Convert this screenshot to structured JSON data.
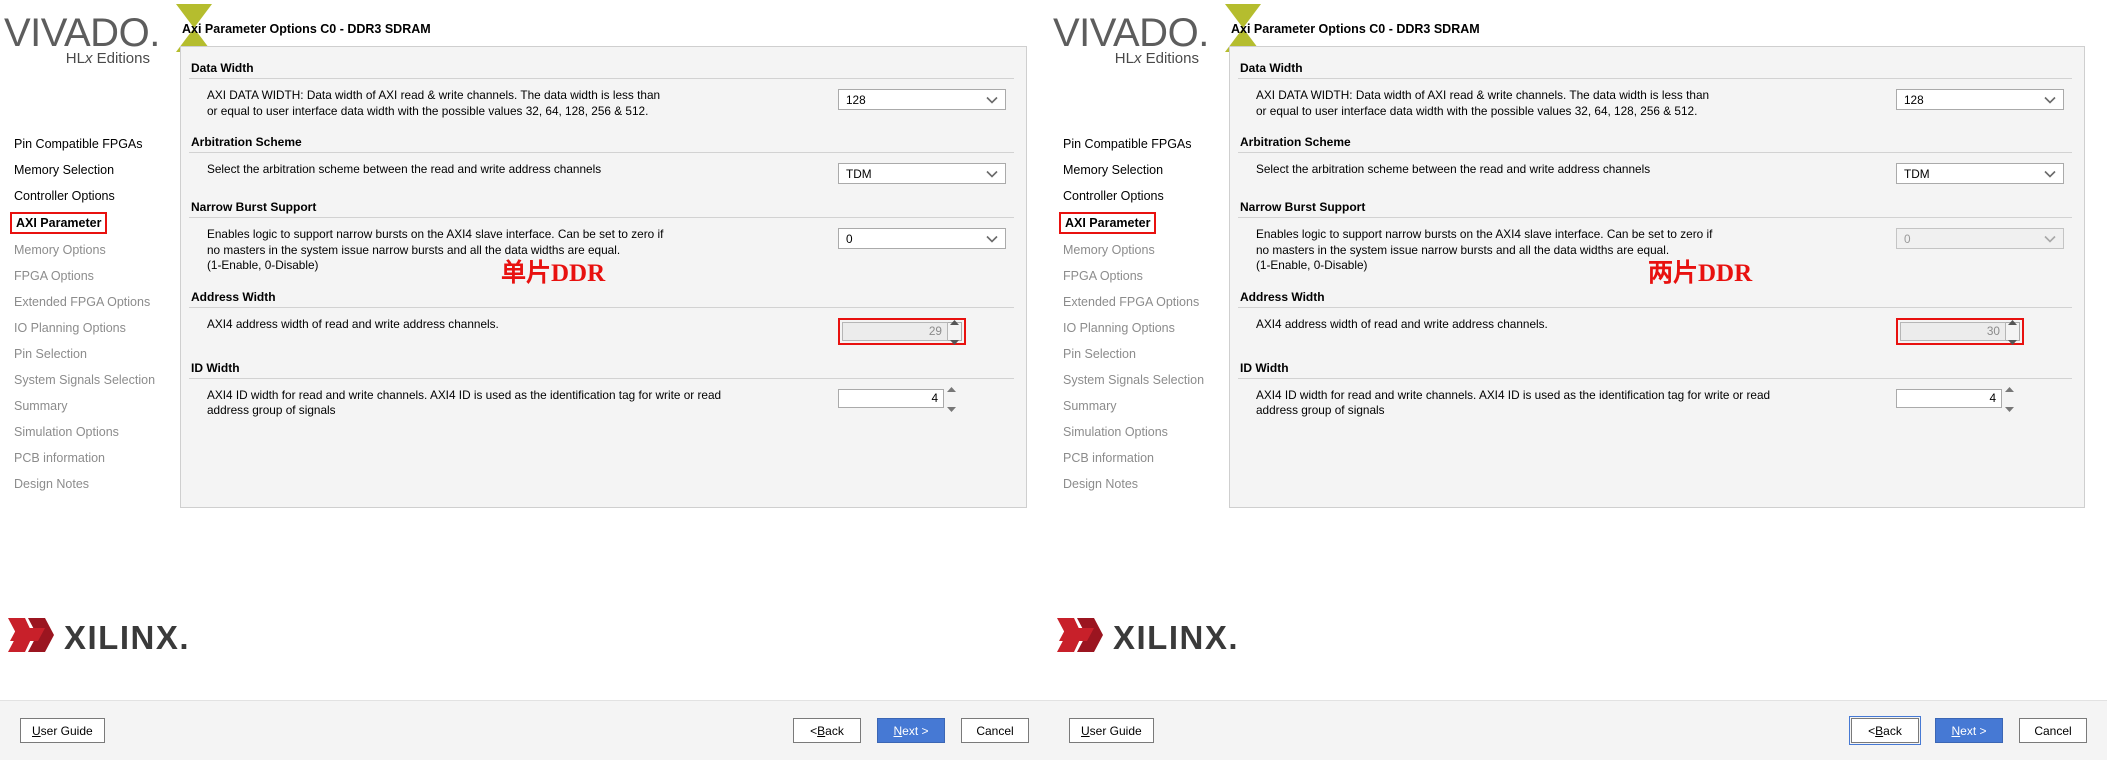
{
  "app": {
    "logo_word": "VIVADO",
    "logo_dot": ".",
    "logo_sub_pre": "HL",
    "logo_sub_ital": "x",
    "logo_sub_post": " Editions",
    "vendor_word": "XILINX",
    "vendor_dot": "."
  },
  "sidebar": {
    "items": [
      {
        "label": "Pin Compatible FPGAs",
        "state": "done"
      },
      {
        "label": "Memory Selection",
        "state": "done"
      },
      {
        "label": "Controller Options",
        "state": "done"
      },
      {
        "label": "AXI Parameter",
        "state": "current"
      },
      {
        "label": "Memory Options",
        "state": "pending"
      },
      {
        "label": "FPGA Options",
        "state": "pending"
      },
      {
        "label": "Extended FPGA Options",
        "state": "pending"
      },
      {
        "label": "IO Planning Options",
        "state": "pending"
      },
      {
        "label": "Pin Selection",
        "state": "pending"
      },
      {
        "label": "System Signals Selection",
        "state": "pending"
      },
      {
        "label": "Summary",
        "state": "pending"
      },
      {
        "label": "Simulation Options",
        "state": "pending"
      },
      {
        "label": "PCB information",
        "state": "pending"
      },
      {
        "label": "Design Notes",
        "state": "pending"
      }
    ]
  },
  "dialog": {
    "title": "Axi Parameter Options C0 - DDR3 SDRAM",
    "groups": {
      "data_width": {
        "title": "Data Width",
        "desc_line1": "AXI DATA WIDTH: Data width of AXI read & write channels. The data width is less than",
        "desc_line2": "or equal to user interface data width with the possible values 32, 64, 128, 256 & 512."
      },
      "arbitration": {
        "title": "Arbitration Scheme",
        "desc_line1": "Select the arbitration scheme between the read and write address channels"
      },
      "narrow_burst": {
        "title": "Narrow Burst Support",
        "desc_line1": "Enables logic to support narrow bursts on the AXI4 slave interface. Can be set to zero if",
        "desc_line2": "no masters in the system issue narrow bursts and all the data widths are equal.",
        "desc_line3": "(1-Enable, 0-Disable)"
      },
      "address_width": {
        "title": "Address Width",
        "desc_line1": "AXI4 address width of read and write address channels."
      },
      "id_width": {
        "title": "ID Width",
        "desc_line1": "AXI4 ID width for read and write channels. AXI4 ID is used as the identification tag for write or read",
        "desc_line2": "address group of signals"
      }
    }
  },
  "left_panel": {
    "annotation": "单片DDR",
    "values": {
      "data_width": "128",
      "arbitration": "TDM",
      "narrow_burst": "0",
      "address_width": "29",
      "id_width": "4"
    },
    "narrow_burst_enabled": true
  },
  "right_panel": {
    "annotation": "两片DDR",
    "values": {
      "data_width": "128",
      "arbitration": "TDM",
      "narrow_burst": "0",
      "address_width": "30",
      "id_width": "4"
    },
    "narrow_burst_enabled": false
  },
  "footer": {
    "user_guide": {
      "pre": "",
      "u": "U",
      "post": "ser Guide"
    },
    "back": {
      "pre": "< ",
      "u": "B",
      "post": "ack"
    },
    "next": {
      "pre": "",
      "u": "N",
      "post": "ext >"
    },
    "cancel": {
      "pre": "Cancel",
      "u": "",
      "post": ""
    }
  },
  "colors": {
    "accent_red": "#e8110f",
    "primary_blue": "#4679d4",
    "vivado_green": "#b5bd2e",
    "xilinx_red": "#c8202a"
  }
}
